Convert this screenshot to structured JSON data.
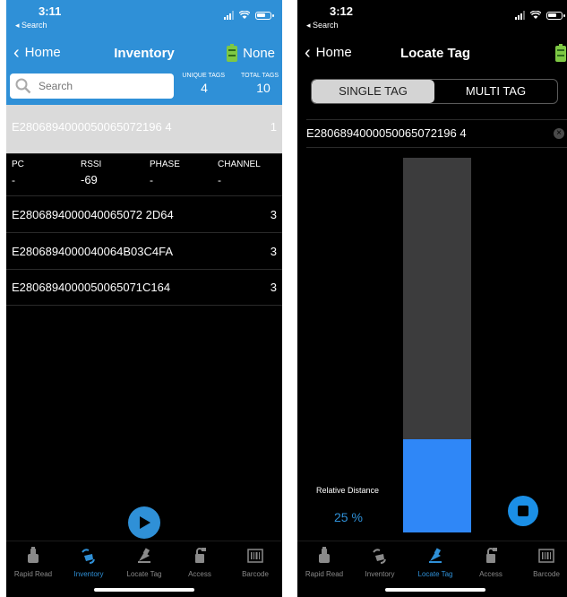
{
  "colors": {
    "accent": "#2f90d7",
    "gauge_fill": "#2f87f7",
    "battery": "#7ec844"
  },
  "left": {
    "status": {
      "time": "3:11",
      "back": "◂ Search"
    },
    "nav": {
      "back_label": "Home",
      "title": "Inventory",
      "battery_status": "None"
    },
    "search": {
      "placeholder": "Search"
    },
    "counts": {
      "unique_label": "UNIQUE TAGS",
      "unique_value": "4",
      "total_label": "TOTAL TAGS",
      "total_value": "10"
    },
    "tags": [
      {
        "epc": "E2806894000050065072196 4",
        "count": "1"
      },
      {
        "epc": "E2806894000040065072 2D64",
        "count": "3"
      },
      {
        "epc": "E2806894000040064B03C4FA",
        "count": "3"
      },
      {
        "epc": "E2806894000050065071C164",
        "count": "3"
      }
    ],
    "details": {
      "pc_label": "PC",
      "pc_value": "-",
      "rssi_label": "RSSI",
      "rssi_value": "-69",
      "phase_label": "PHASE",
      "phase_value": "-",
      "channel_label": "CHANNEL",
      "channel_value": "-"
    }
  },
  "right": {
    "status": {
      "time": "3:12",
      "back": "◂ Search"
    },
    "nav": {
      "back_label": "Home",
      "title": "Locate Tag"
    },
    "segments": {
      "single": "SINGLE TAG",
      "multi": "MULTI TAG",
      "selected": "single"
    },
    "epc_value": "E2806894000050065072196 4",
    "relative_distance": {
      "label": "Relative Distance",
      "value_text": "25 %",
      "value": 25
    }
  },
  "tabs": [
    {
      "label": "Rapid Read",
      "icon": "rapid-read-icon"
    },
    {
      "label": "Inventory",
      "icon": "inventory-icon"
    },
    {
      "label": "Locate Tag",
      "icon": "locate-tag-icon"
    },
    {
      "label": "Access",
      "icon": "access-icon"
    },
    {
      "label": "Barcode",
      "icon": "barcode-icon"
    }
  ],
  "active_tab": {
    "left": "Inventory",
    "right": "Locate Tag"
  }
}
